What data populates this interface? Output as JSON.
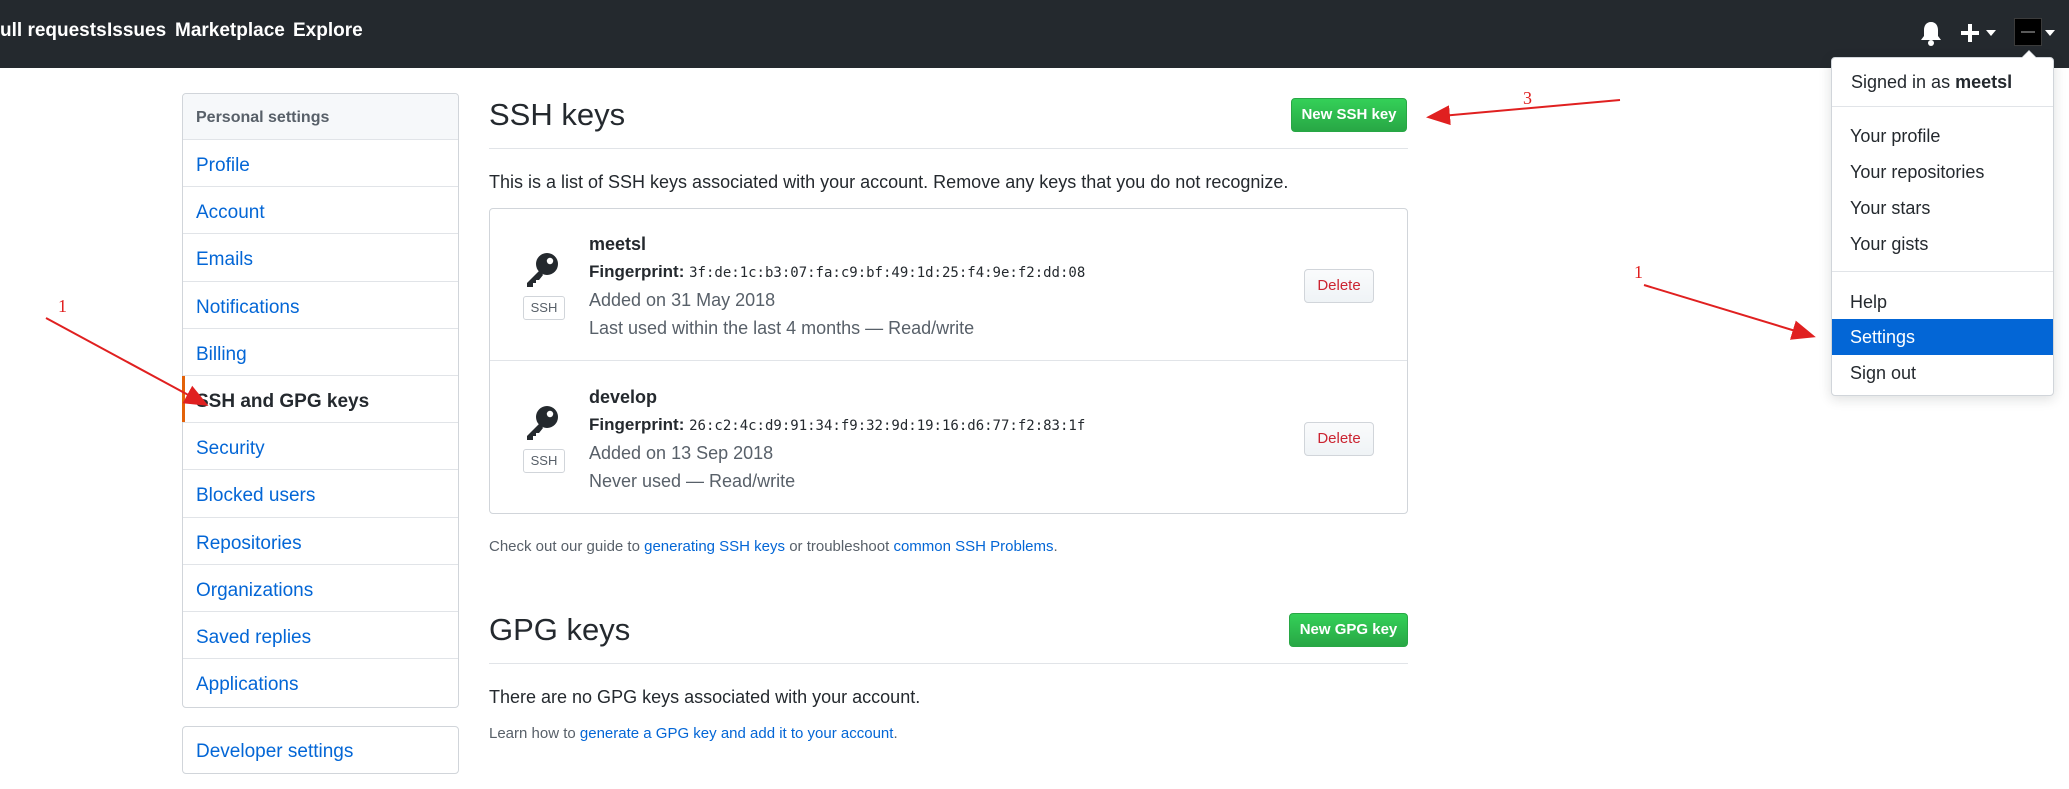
{
  "header": {
    "nav": [
      "ull requests",
      "Issues",
      "Marketplace",
      "Explore"
    ],
    "icons": [
      "bell-icon",
      "plus-icon",
      "avatar"
    ]
  },
  "sidebar": {
    "heading": "Personal settings",
    "items": [
      {
        "label": "Profile"
      },
      {
        "label": "Account"
      },
      {
        "label": "Emails"
      },
      {
        "label": "Notifications"
      },
      {
        "label": "Billing"
      },
      {
        "label": "SSH and GPG keys",
        "selected": true
      },
      {
        "label": "Security"
      },
      {
        "label": "Blocked users"
      },
      {
        "label": "Repositories"
      },
      {
        "label": "Organizations"
      },
      {
        "label": "Saved replies"
      },
      {
        "label": "Applications"
      }
    ],
    "developer": "Developer settings"
  },
  "ssh": {
    "title": "SSH keys",
    "new_button": "New SSH key",
    "intro": "This is a list of SSH keys associated with your account. Remove any keys that you do not recognize.",
    "keys": [
      {
        "name": "meetsl",
        "fingerprint_label": "Fingerprint:",
        "fingerprint": "3f:de:1c:b3:07:fa:c9:bf:49:1d:25:f4:9e:f2:dd:08",
        "added": "Added on 31 May 2018",
        "used": "Last used within the last 4 months — Read/write",
        "badge": "SSH",
        "delete": "Delete"
      },
      {
        "name": "develop",
        "fingerprint_label": "Fingerprint:",
        "fingerprint": "26:c2:4c:d9:91:34:f9:32:9d:19:16:d6:77:f2:83:1f",
        "added": "Added on 13 Sep 2018",
        "used": "Never used — Read/write",
        "badge": "SSH",
        "delete": "Delete"
      }
    ],
    "guide_prefix": "Check out our guide to ",
    "guide_link1": "generating SSH keys",
    "guide_middle": " or troubleshoot ",
    "guide_link2": "common SSH Problems",
    "guide_suffix": "."
  },
  "gpg": {
    "title": "GPG keys",
    "new_button": "New GPG key",
    "empty": "There are no GPG keys associated with your account.",
    "learn_prefix": "Learn how to ",
    "learn_link": "generate a GPG key and add it to your account",
    "learn_suffix": "."
  },
  "dropdown": {
    "signed_in_prefix": "Signed in as ",
    "username": "meetsl",
    "items": [
      "Your profile",
      "Your repositories",
      "Your stars",
      "Your gists",
      "Help",
      "Settings",
      "Sign out"
    ],
    "active": "Settings"
  },
  "annotations": [
    "1",
    "1",
    "3"
  ],
  "colors": {
    "header_bg": "#24292e",
    "link": "#0366d6",
    "green": "#28a745",
    "danger": "#cb2431",
    "selected_border": "#e36209",
    "annotation": "#e02020"
  }
}
